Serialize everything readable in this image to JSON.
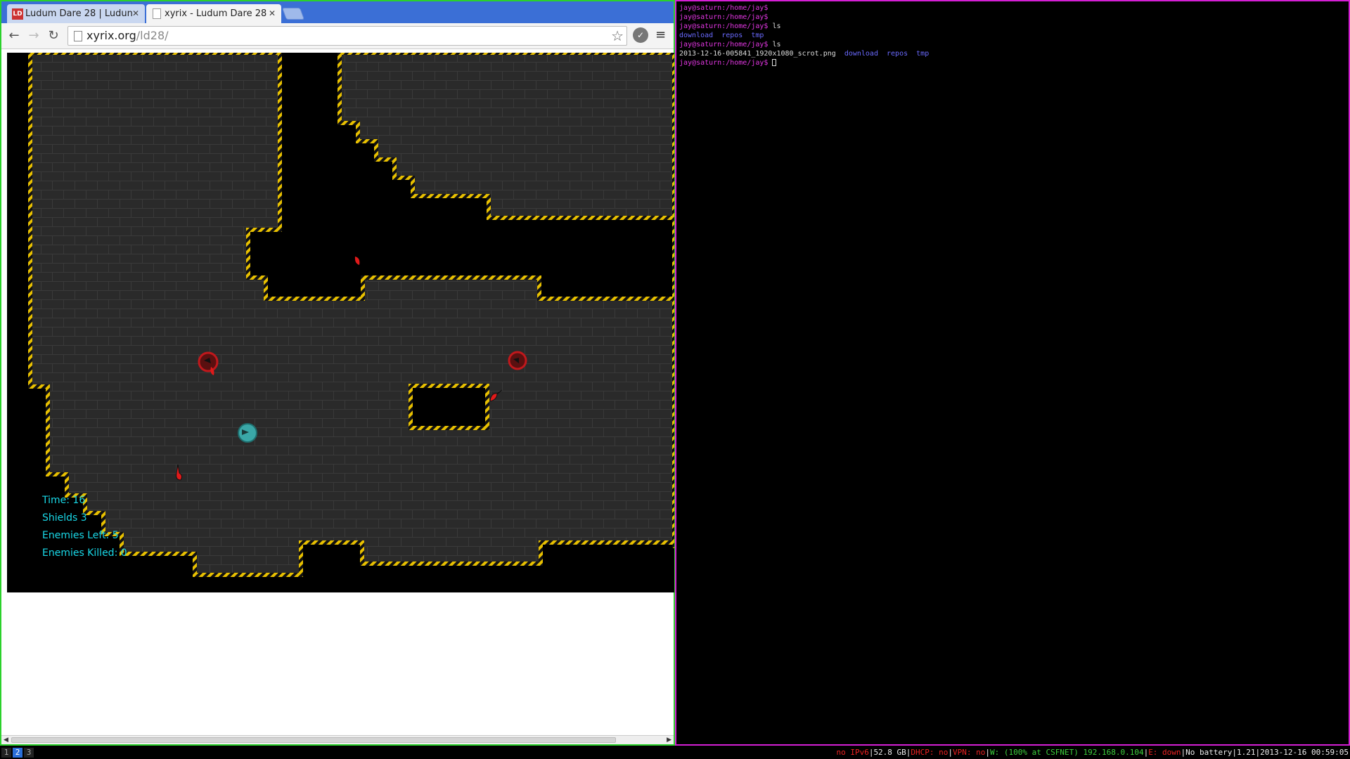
{
  "browser": {
    "tabs": [
      {
        "title": "Ludum Dare 28 | Ludun",
        "favicon": "LD"
      },
      {
        "title": "xyrix - Ludum Dare 28"
      }
    ],
    "url_host": "xyrix.org",
    "url_path": "/ld28/"
  },
  "game": {
    "hud": {
      "time": "Time: 16",
      "shields": "Shields 3",
      "enemies_left": "Enemies Left: 5",
      "enemies_killed": "Enemies Killed: 0"
    }
  },
  "terminal": {
    "lines": [
      {
        "prompt": "jay@saturn:/home/jay$",
        "cmd": ""
      },
      {
        "prompt": "jay@saturn:/home/jay$",
        "cmd": ""
      },
      {
        "prompt": "jay@saturn:/home/jay$",
        "cmd": " ls"
      },
      {
        "output_dirs": "download  repos  tmp"
      },
      {
        "prompt": "jay@saturn:/home/jay$",
        "cmd": " ls"
      },
      {
        "output_file": "2013-12-16-005841_1920x1080_scrot.png",
        "output_dirs": "download  repos  tmp"
      },
      {
        "prompt": "jay@saturn:/home/jay$",
        "cmd": " ",
        "cursor": true
      }
    ]
  },
  "statusbar": {
    "workspaces": [
      "1",
      "2",
      "3"
    ],
    "active_workspace": "2",
    "ipv6": "no IPv6",
    "disk": "52.8 GB",
    "dhcp": "DHCP: no",
    "vpn": "VPN: no",
    "wifi": "W: (100% at CSFNET) 192.168.0.104",
    "ethernet": "E: down",
    "battery": "No battery",
    "load": "1.21",
    "datetime": "2013-12-16 00:59:05"
  },
  "colors": {
    "browser_border": "#2bd12b",
    "terminal_border": "#d41fd4",
    "hud_text": "#19d9e8",
    "hazard_yellow": "#e8c000",
    "floor": "#2a2a2a",
    "enemy_red": "#c0181c",
    "player_teal": "#3aa7a7"
  }
}
